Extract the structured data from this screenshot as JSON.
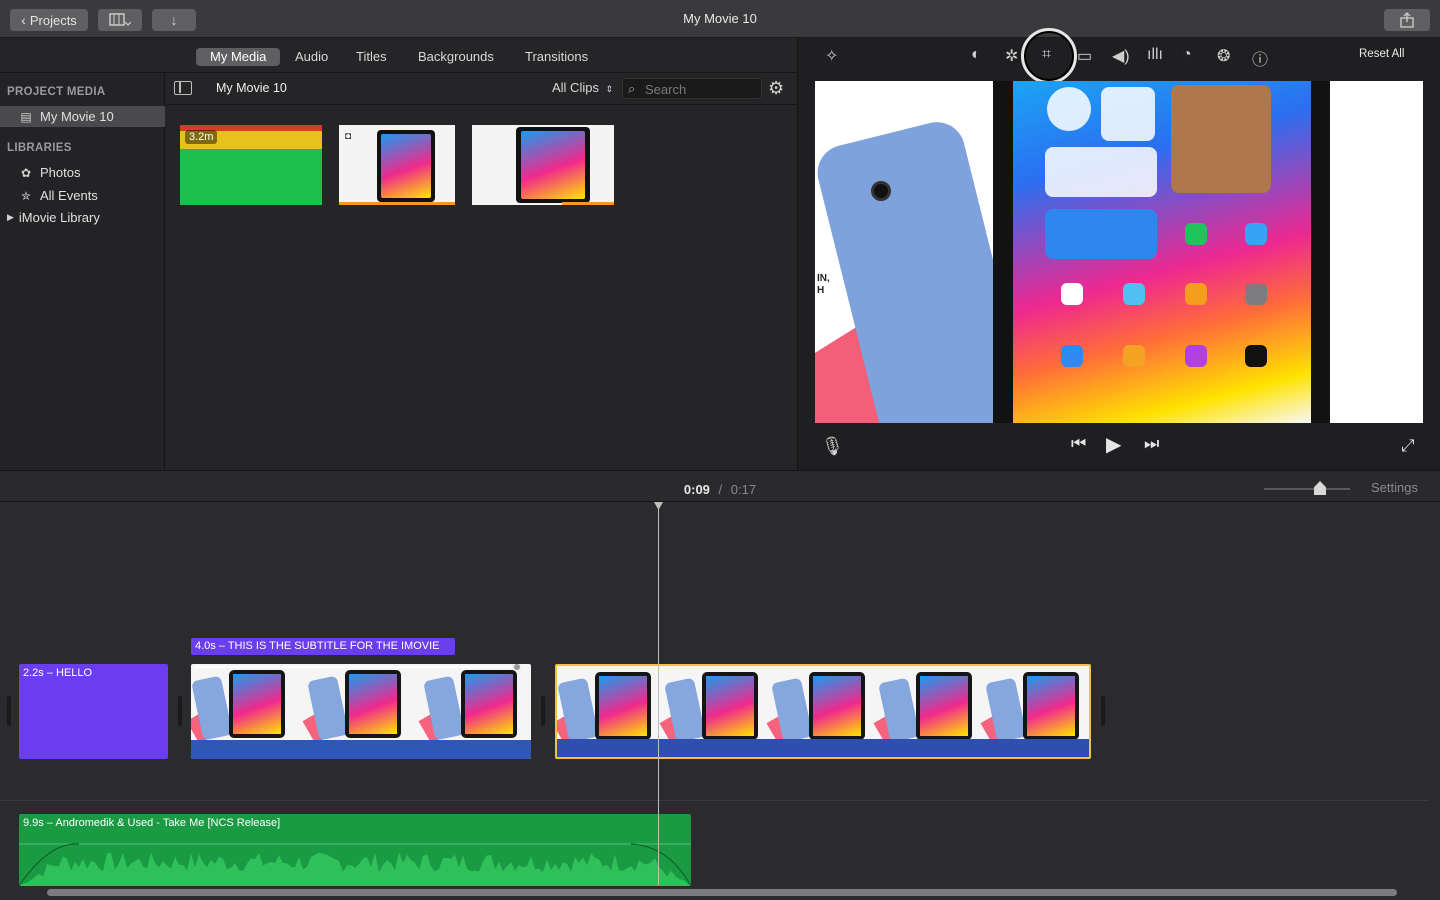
{
  "window": {
    "title": "My Movie 10"
  },
  "titlebar": {
    "projects_label": "Projects"
  },
  "media_tabs": [
    {
      "label": "My Media",
      "active": true
    },
    {
      "label": "Audio",
      "active": false
    },
    {
      "label": "Titles",
      "active": false
    },
    {
      "label": "Backgrounds",
      "active": false
    },
    {
      "label": "Transitions",
      "active": false
    }
  ],
  "sidebar": {
    "project_media_heading": "PROJECT MEDIA",
    "project_item": "My Movie 10",
    "libraries_heading": "LIBRARIES",
    "library_items": [
      {
        "label": "Photos",
        "icon": "photos-icon"
      },
      {
        "label": "All Events",
        "icon": "star-icon"
      }
    ],
    "library_root": "iMovie Library"
  },
  "browser": {
    "event_title": "My Movie 10",
    "filter_label": "All Clips",
    "search_placeholder": "Search",
    "clips": [
      {
        "duration_label": "3.2m"
      },
      {
        "duration_label": ""
      },
      {
        "duration_label": ""
      }
    ]
  },
  "viewer": {
    "reset_all_label": "Reset All",
    "preview_side_text": "IN,\nH"
  },
  "timeline": {
    "current_time": "0:09",
    "separator": "/",
    "total_time": "0:17",
    "settings_label": "Settings",
    "title_clip_label": "2.2s – HELLO",
    "subtitle_clip_label": "4.0s – THIS IS THE SUBTITLE FOR THE IMOVIE",
    "music_clip_label": "9.9s – Andromedik & Used - Take Me [NCS Release]"
  },
  "colors": {
    "title_clip": "#6b3df0",
    "music_clip": "#1a9a43",
    "selected_clip_border": "#f0c43a",
    "audio_strip": "#2f57b8"
  }
}
